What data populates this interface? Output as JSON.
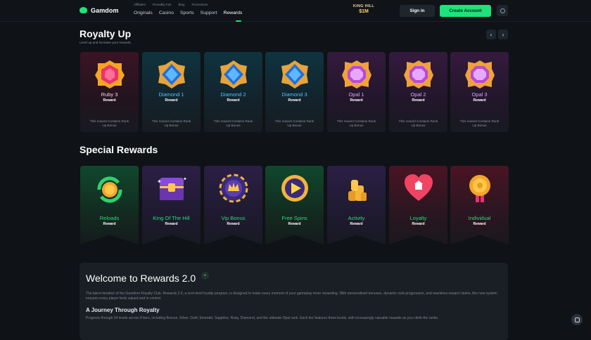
{
  "header": {
    "logo_text": "Gamdom",
    "small_links": [
      "Affiliates",
      "Provably Fair",
      "Blog",
      "Promotions"
    ],
    "main_links": [
      "Originals",
      "Casino",
      "Sports",
      "Support",
      "Rewards"
    ],
    "active_link": "Rewards",
    "promo_line1": "KING HILL",
    "promo_line2": "$1M",
    "signin_label": "Sign in",
    "create_label": "Create Account"
  },
  "royalty": {
    "title": "Royalty Up",
    "subtitle": "Level up and increase your rewards",
    "prev_icon": "‹",
    "next_icon": "›",
    "cards": [
      {
        "name": "Ruby 3",
        "tag": "Reward",
        "desc": "This reward Contains Rank Up Bonus",
        "tier": "ruby"
      },
      {
        "name": "Diamond 1",
        "tag": "Reward",
        "desc": "This reward Contains Rank Up Bonus",
        "tier": "diamond"
      },
      {
        "name": "Diamond 2",
        "tag": "Reward",
        "desc": "This reward Contains Rank Up Bonus",
        "tier": "diamond"
      },
      {
        "name": "Diamond 3",
        "tag": "Reward",
        "desc": "This reward Contains Rank Up Bonus",
        "tier": "diamond"
      },
      {
        "name": "Opal 1",
        "tag": "Reward",
        "desc": "This reward Contains Rank Up Bonus",
        "tier": "opal"
      },
      {
        "name": "Opal 2",
        "tag": "Reward",
        "desc": "This reward Contains Rank Up Bonus",
        "tier": "opal"
      },
      {
        "name": "Opal 3",
        "tag": "Reward",
        "desc": "This reward Contains Rank Up Bonus",
        "tier": "opal"
      }
    ]
  },
  "special": {
    "title": "Special Rewards",
    "cards": [
      {
        "name": "Reloads",
        "tag": "Reward",
        "icon": "reload-coin-icon"
      },
      {
        "name": "King Of The Hill",
        "tag": "Reward",
        "icon": "treasure-chest-icon"
      },
      {
        "name": "Vip Bonus",
        "tag": "Reward",
        "icon": "vip-chip-icon"
      },
      {
        "name": "Free Spins",
        "tag": "Reward",
        "icon": "play-icon"
      },
      {
        "name": "Activity",
        "tag": "Reward",
        "icon": "coin-stack-icon"
      },
      {
        "name": "Loyalty",
        "tag": "Reward",
        "icon": "heart-icon"
      },
      {
        "name": "Individual",
        "tag": "Reward",
        "icon": "medal-icon"
      }
    ]
  },
  "welcome": {
    "title": "Welcome to Rewards 2.0",
    "badge": "+",
    "para": "The latest iteration of the Gamdom Royalty Club, Rewards 2.0, a next-level loyalty program, is designed to make every moment of your gameplay more rewarding. With personalised bonuses, dynamic rank progression, and seamless reward claims, this new system ensures every player feels valued and in control.",
    "h2": "A Journey Through Royalty",
    "para2": "Progress through 24 levels across 8 tiers, including Bronze, Silver, Gold, Emerald, Sapphire, Ruby, Diamond, and the ultimate Opal rank. Each tier features three levels, with increasingly valuable rewards as you climb the ranks."
  },
  "colors": {
    "accent": "#1fe27a",
    "diamond": "#47c8ff",
    "opal": "#d9a6ff",
    "background": "#0f1216"
  }
}
